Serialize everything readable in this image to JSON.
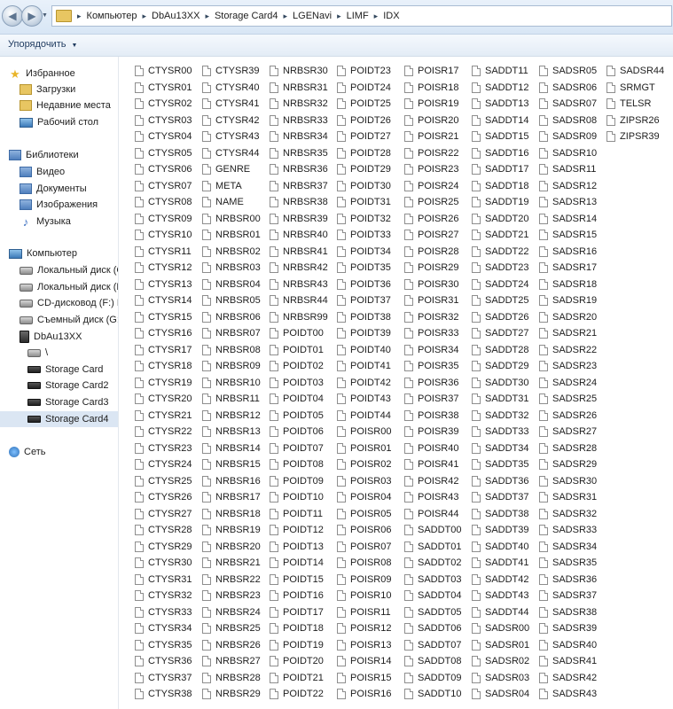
{
  "address_bar": {
    "breadcrumbs": [
      "Компьютер",
      "DbAu13XX",
      "Storage Card4",
      "LGENavi",
      "LIMF",
      "IDX"
    ]
  },
  "toolbar": {
    "organize_label": "Упорядочить"
  },
  "nav": {
    "items": [
      {
        "label": "Избранное",
        "icon": "star-icon"
      },
      {
        "label": "Загрузки",
        "icon": "folder-icon"
      },
      {
        "label": "Недавние места",
        "icon": "folder-icon"
      },
      {
        "label": "Рабочий стол",
        "icon": "desktop-icon"
      },
      {
        "label": "Библиотеки",
        "icon": "library-icon"
      },
      {
        "label": "Видео",
        "icon": "library-icon"
      },
      {
        "label": "Документы",
        "icon": "library-icon"
      },
      {
        "label": "Изображения",
        "icon": "library-icon"
      },
      {
        "label": "Музыка",
        "icon": "music-icon"
      },
      {
        "label": "Компьютер",
        "icon": "computer-icon"
      },
      {
        "label": "Локальный диск (C",
        "icon": "drive-icon"
      },
      {
        "label": "Локальный диск (D",
        "icon": "drive-icon"
      },
      {
        "label": "CD-дисковод (F:) Be",
        "icon": "drive-icon"
      },
      {
        "label": "Съемный диск (G:)",
        "icon": "drive-icon"
      },
      {
        "label": "DbAu13XX",
        "icon": "device-icon"
      },
      {
        "label": "\\",
        "icon": "drive-icon"
      },
      {
        "label": "Storage Card",
        "icon": "card-icon"
      },
      {
        "label": "Storage Card2",
        "icon": "card-icon"
      },
      {
        "label": "Storage Card3",
        "icon": "card-icon"
      },
      {
        "label": "Storage Card4",
        "icon": "card-icon",
        "selected": true
      },
      {
        "label": "Сеть",
        "icon": "network-icon"
      }
    ]
  },
  "files": {
    "columns": [
      [
        "CTYSR00",
        "CTYSR01",
        "CTYSR02",
        "CTYSR03",
        "CTYSR04",
        "CTYSR05",
        "CTYSR06",
        "CTYSR07",
        "CTYSR08",
        "CTYSR09",
        "CTYSR10",
        "CTYSR11",
        "CTYSR12",
        "CTYSR13",
        "CTYSR14",
        "CTYSR15",
        "CTYSR16",
        "CTYSR17",
        "CTYSR18",
        "CTYSR19",
        "CTYSR20",
        "CTYSR21",
        "CTYSR22",
        "CTYSR23",
        "CTYSR24",
        "CTYSR25",
        "CTYSR26",
        "CTYSR27",
        "CTYSR28",
        "CTYSR29",
        "CTYSR30",
        "CTYSR31",
        "CTYSR32",
        "CTYSR33",
        "CTYSR34",
        "CTYSR35",
        "CTYSR36",
        "CTYSR37",
        "CTYSR38"
      ],
      [
        "CTYSR39",
        "CTYSR40",
        "CTYSR41",
        "CTYSR42",
        "CTYSR43",
        "CTYSR44",
        "GENRE",
        "META",
        "NAME",
        "NRBSR00",
        "NRBSR01",
        "NRBSR02",
        "NRBSR03",
        "NRBSR04",
        "NRBSR05",
        "NRBSR06",
        "NRBSR07",
        "NRBSR08",
        "NRBSR09",
        "NRBSR10",
        "NRBSR11",
        "NRBSR12",
        "NRBSR13",
        "NRBSR14",
        "NRBSR15",
        "NRBSR16",
        "NRBSR17",
        "NRBSR18",
        "NRBSR19",
        "NRBSR20",
        "NRBSR21",
        "NRBSR22",
        "NRBSR23",
        "NRBSR24",
        "NRBSR25",
        "NRBSR26",
        "NRBSR27",
        "NRBSR28",
        "NRBSR29"
      ],
      [
        "NRBSR30",
        "NRBSR31",
        "NRBSR32",
        "NRBSR33",
        "NRBSR34",
        "NRBSR35",
        "NRBSR36",
        "NRBSR37",
        "NRBSR38",
        "NRBSR39",
        "NRBSR40",
        "NRBSR41",
        "NRBSR42",
        "NRBSR43",
        "NRBSR44",
        "NRBSR99",
        "POIDT00",
        "POIDT01",
        "POIDT02",
        "POIDT03",
        "POIDT04",
        "POIDT05",
        "POIDT06",
        "POIDT07",
        "POIDT08",
        "POIDT09",
        "POIDT10",
        "POIDT11",
        "POIDT12",
        "POIDT13",
        "POIDT14",
        "POIDT15",
        "POIDT16",
        "POIDT17",
        "POIDT18",
        "POIDT19",
        "POIDT20",
        "POIDT21",
        "POIDT22"
      ],
      [
        "POIDT23",
        "POIDT24",
        "POIDT25",
        "POIDT26",
        "POIDT27",
        "POIDT28",
        "POIDT29",
        "POIDT30",
        "POIDT31",
        "POIDT32",
        "POIDT33",
        "POIDT34",
        "POIDT35",
        "POIDT36",
        "POIDT37",
        "POIDT38",
        "POIDT39",
        "POIDT40",
        "POIDT41",
        "POIDT42",
        "POIDT43",
        "POIDT44",
        "POISR00",
        "POISR01",
        "POISR02",
        "POISR03",
        "POISR04",
        "POISR05",
        "POISR06",
        "POISR07",
        "POISR08",
        "POISR09",
        "POISR10",
        "POISR11",
        "POISR12",
        "POISR13",
        "POISR14",
        "POISR15",
        "POISR16"
      ],
      [
        "POISR17",
        "POISR18",
        "POISR19",
        "POISR20",
        "POISR21",
        "POISR22",
        "POISR23",
        "POISR24",
        "POISR25",
        "POISR26",
        "POISR27",
        "POISR28",
        "POISR29",
        "POISR30",
        "POISR31",
        "POISR32",
        "POISR33",
        "POISR34",
        "POISR35",
        "POISR36",
        "POISR37",
        "POISR38",
        "POISR39",
        "POISR40",
        "POISR41",
        "POISR42",
        "POISR43",
        "POISR44",
        "SADDT00",
        "SADDT01",
        "SADDT02",
        "SADDT03",
        "SADDT04",
        "SADDT05",
        "SADDT06",
        "SADDT07",
        "SADDT08",
        "SADDT09",
        "SADDT10"
      ],
      [
        "SADDT11",
        "SADDT12",
        "SADDT13",
        "SADDT14",
        "SADDT15",
        "SADDT16",
        "SADDT17",
        "SADDT18",
        "SADDT19",
        "SADDT20",
        "SADDT21",
        "SADDT22",
        "SADDT23",
        "SADDT24",
        "SADDT25",
        "SADDT26",
        "SADDT27",
        "SADDT28",
        "SADDT29",
        "SADDT30",
        "SADDT31",
        "SADDT32",
        "SADDT33",
        "SADDT34",
        "SADDT35",
        "SADDT36",
        "SADDT37",
        "SADDT38",
        "SADDT39",
        "SADDT40",
        "SADDT41",
        "SADDT42",
        "SADDT43",
        "SADDT44",
        "SADSR00",
        "SADSR01",
        "SADSR02",
        "SADSR03",
        "SADSR04"
      ],
      [
        "SADSR05",
        "SADSR06",
        "SADSR07",
        "SADSR08",
        "SADSR09",
        "SADSR10",
        "SADSR11",
        "SADSR12",
        "SADSR13",
        "SADSR14",
        "SADSR15",
        "SADSR16",
        "SADSR17",
        "SADSR18",
        "SADSR19",
        "SADSR20",
        "SADSR21",
        "SADSR22",
        "SADSR23",
        "SADSR24",
        "SADSR25",
        "SADSR26",
        "SADSR27",
        "SADSR28",
        "SADSR29",
        "SADSR30",
        "SADSR31",
        "SADSR32",
        "SADSR33",
        "SADSR34",
        "SADSR35",
        "SADSR36",
        "SADSR37",
        "SADSR38",
        "SADSR39",
        "SADSR40",
        "SADSR41",
        "SADSR42",
        "SADSR43"
      ],
      [
        "SADSR44",
        "SRMGT",
        "TELSR",
        "ZIPSR26",
        "ZIPSR39"
      ]
    ]
  }
}
